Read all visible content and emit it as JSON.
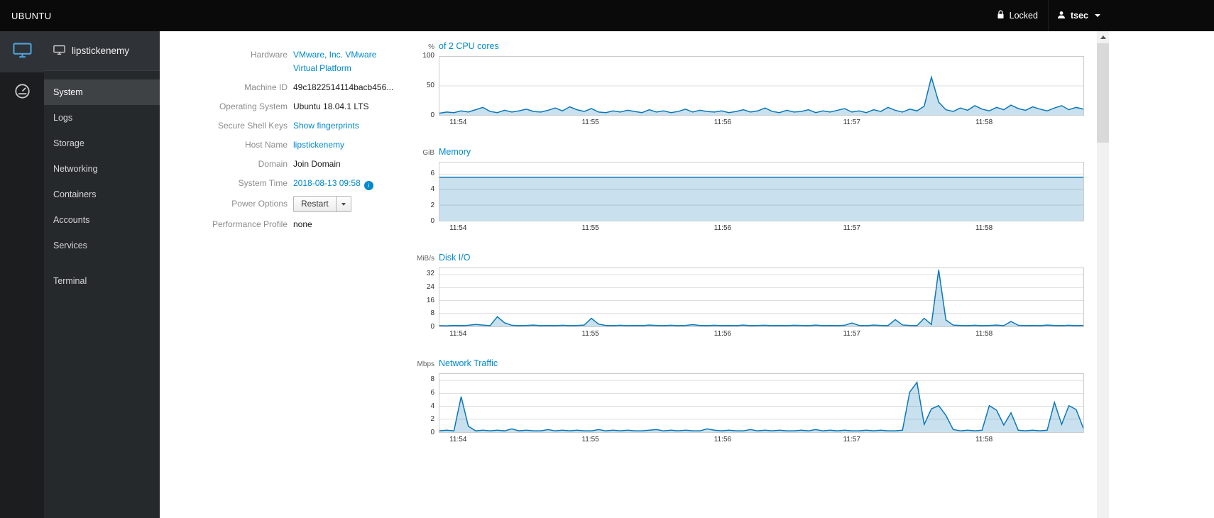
{
  "topbar": {
    "brand": "UBUNTU",
    "locked_label": "Locked",
    "user_label": "tsec"
  },
  "sidebar": {
    "host": "lipstickenemy",
    "items": [
      {
        "label": "System"
      },
      {
        "label": "Logs"
      },
      {
        "label": "Storage"
      },
      {
        "label": "Networking"
      },
      {
        "label": "Containers"
      },
      {
        "label": "Accounts"
      },
      {
        "label": "Services"
      },
      {
        "label": "Terminal"
      }
    ]
  },
  "info": {
    "hardware": {
      "label": "Hardware",
      "value": "VMware, Inc. VMware Virtual Platform"
    },
    "machine_id": {
      "label": "Machine ID",
      "value": "49c1822514114bacb456..."
    },
    "os": {
      "label": "Operating System",
      "value": "Ubuntu 18.04.1 LTS"
    },
    "ssh": {
      "label": "Secure Shell Keys",
      "value": "Show fingerprints"
    },
    "hostname": {
      "label": "Host Name",
      "value": "lipstickenemy"
    },
    "domain": {
      "label": "Domain",
      "value": "Join Domain"
    },
    "time": {
      "label": "System Time",
      "value": "2018-08-13 09:58"
    },
    "power": {
      "label": "Power Options",
      "button": "Restart"
    },
    "profile": {
      "label": "Performance Profile",
      "value": "none"
    }
  },
  "icons": {
    "info_glyph": "i"
  },
  "colors": {
    "accent": "#0088ce",
    "chart_line": "#0b77b5",
    "chart_fill": "rgba(11,119,181,0.22)",
    "topbar_bg": "#0a0a0a",
    "sidebar_bg": "#26292c"
  },
  "chart_data": [
    {
      "type": "area",
      "unit": "%",
      "title": "of 2 CPU cores",
      "ymax": 100,
      "yticks": [
        0,
        50,
        100
      ],
      "xticks": [
        "11:54",
        "11:55",
        "11:56",
        "11:57",
        "11:58"
      ],
      "xtick_pos": [
        0.03,
        0.235,
        0.44,
        0.64,
        0.845
      ],
      "values": [
        3,
        5,
        4,
        7,
        5,
        9,
        13,
        6,
        4,
        8,
        5,
        7,
        10,
        6,
        5,
        8,
        12,
        7,
        14,
        9,
        6,
        11,
        5,
        4,
        7,
        5,
        8,
        6,
        4,
        9,
        5,
        7,
        4,
        6,
        10,
        5,
        8,
        6,
        5,
        7,
        4,
        6,
        9,
        5,
        7,
        12,
        6,
        4,
        8,
        5,
        6,
        9,
        4,
        7,
        5,
        8,
        11,
        5,
        7,
        4,
        9,
        6,
        13,
        8,
        5,
        10,
        7,
        15,
        65,
        22,
        9,
        6,
        12,
        8,
        16,
        10,
        7,
        13,
        9,
        17,
        11,
        8,
        14,
        10,
        7,
        12,
        16,
        9,
        13,
        10
      ]
    },
    {
      "type": "area",
      "unit": "GiB",
      "title": "Memory",
      "ymax": 7.5,
      "yticks": [
        0,
        2,
        4,
        6
      ],
      "xticks": [
        "11:54",
        "11:55",
        "11:56",
        "11:57",
        "11:58"
      ],
      "xtick_pos": [
        0.03,
        0.235,
        0.44,
        0.64,
        0.845
      ],
      "values": [
        5.6,
        5.6,
        5.6,
        5.6,
        5.6,
        5.6,
        5.6,
        5.6,
        5.6,
        5.6,
        5.6,
        5.6,
        5.6,
        5.6,
        5.6,
        5.6,
        5.6,
        5.6,
        5.6,
        5.6
      ]
    },
    {
      "type": "area",
      "unit": "MiB/s",
      "title": "Disk I/O",
      "ymax": 36,
      "yticks": [
        0,
        8,
        16,
        24,
        32
      ],
      "xticks": [
        "11:54",
        "11:55",
        "11:56",
        "11:57",
        "11:58"
      ],
      "xtick_pos": [
        0.03,
        0.235,
        0.44,
        0.64,
        0.845
      ],
      "values": [
        0.5,
        0.4,
        0.6,
        0.5,
        0.7,
        1.2,
        0.8,
        0.5,
        6,
        2.2,
        0.7,
        0.5,
        0.6,
        0.8,
        0.5,
        0.6,
        0.5,
        0.7,
        0.5,
        0.6,
        0.8,
        5,
        1.4,
        0.6,
        0.5,
        0.7,
        0.5,
        0.6,
        0.5,
        0.8,
        0.6,
        0.5,
        0.7,
        0.5,
        0.6,
        1.1,
        0.6,
        0.5,
        0.7,
        0.5,
        0.6,
        0.5,
        0.8,
        0.5,
        0.6,
        0.7,
        0.5,
        0.6,
        0.5,
        0.7,
        0.6,
        0.5,
        0.8,
        0.5,
        0.6,
        0.5,
        0.7,
        2.1,
        0.6,
        0.5,
        0.8,
        0.6,
        0.5,
        4.2,
        0.9,
        0.6,
        0.5,
        5,
        1.2,
        35,
        4,
        0.8,
        0.6,
        0.5,
        0.7,
        0.5,
        0.6,
        0.8,
        0.5,
        3.1,
        0.7,
        0.5,
        0.6,
        0.5,
        0.8,
        0.6,
        0.5,
        0.7,
        0.5,
        0.6
      ]
    },
    {
      "type": "area",
      "unit": "Mbps",
      "title": "Network Traffic",
      "ymax": 9,
      "yticks": [
        0,
        2,
        4,
        6,
        8
      ],
      "xticks": [
        "11:54",
        "11:55",
        "11:56",
        "11:57",
        "11:58"
      ],
      "xtick_pos": [
        0.03,
        0.235,
        0.44,
        0.64,
        0.845
      ],
      "values": [
        0.2,
        0.3,
        0.2,
        5.5,
        0.9,
        0.2,
        0.3,
        0.2,
        0.3,
        0.2,
        0.5,
        0.2,
        0.3,
        0.2,
        0.2,
        0.4,
        0.2,
        0.3,
        0.2,
        0.3,
        0.2,
        0.2,
        0.4,
        0.2,
        0.3,
        0.2,
        0.3,
        0.2,
        0.2,
        0.3,
        0.4,
        0.2,
        0.3,
        0.2,
        0.3,
        0.2,
        0.2,
        0.5,
        0.3,
        0.2,
        0.3,
        0.2,
        0.2,
        0.4,
        0.2,
        0.3,
        0.2,
        0.3,
        0.2,
        0.2,
        0.3,
        0.2,
        0.4,
        0.2,
        0.3,
        0.2,
        0.3,
        0.2,
        0.2,
        0.3,
        0.2,
        0.3,
        0.2,
        0.2,
        0.3,
        6.2,
        7.7,
        1.2,
        3.6,
        4.1,
        2.6,
        0.4,
        0.2,
        0.3,
        0.2,
        0.3,
        4.1,
        3.4,
        1.1,
        3.0,
        0.3,
        0.2,
        0.3,
        0.2,
        0.3,
        4.6,
        1.2,
        4.1,
        3.5,
        0.6
      ]
    }
  ]
}
